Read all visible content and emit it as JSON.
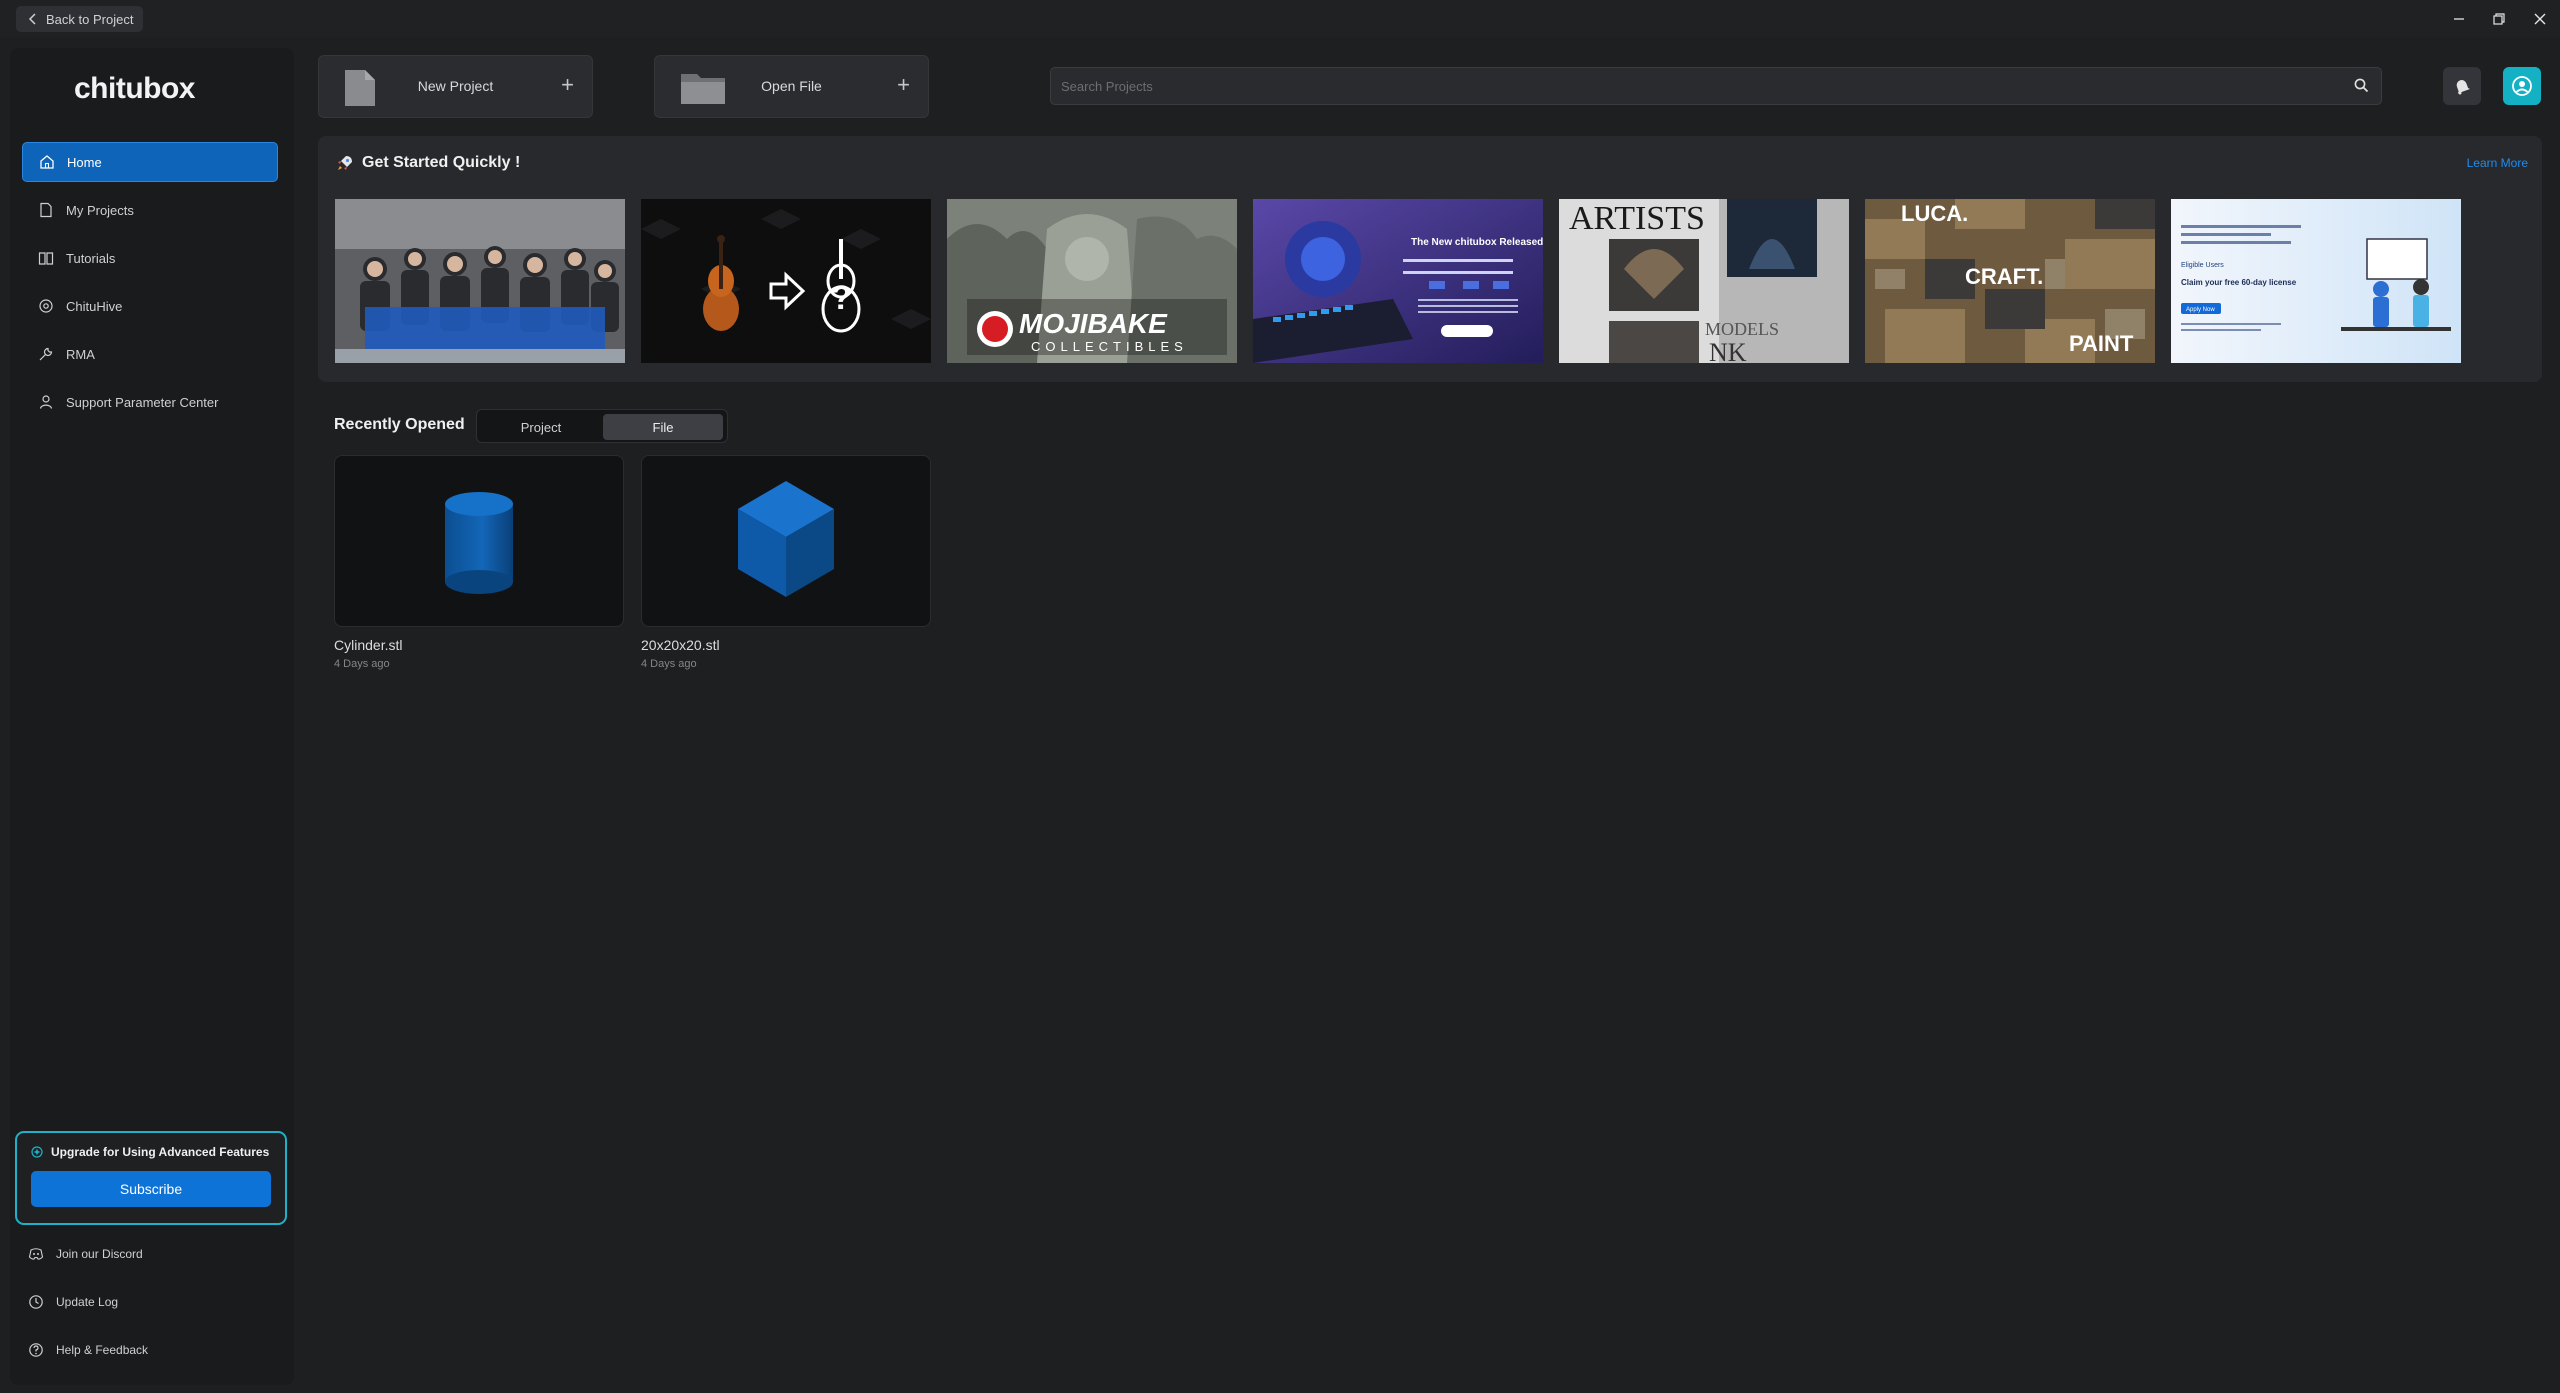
{
  "titlebar": {
    "back_label": "Back to Project",
    "controls": [
      "minimize-icon",
      "restore-icon",
      "close-icon"
    ]
  },
  "sidebar": {
    "logo": "chitubox",
    "items": [
      {
        "label": "Home",
        "icon": "home-icon",
        "active": true
      },
      {
        "label": "My Projects",
        "icon": "document-icon"
      },
      {
        "label": "Tutorials",
        "icon": "book-icon"
      },
      {
        "label": "ChituHive",
        "icon": "hive-icon"
      },
      {
        "label": "RMA",
        "icon": "wrench-icon"
      },
      {
        "label": "Support Parameter Center",
        "icon": "support-icon"
      }
    ],
    "upgrade": {
      "title": "Upgrade for Using Advanced Features",
      "button": "Subscribe"
    },
    "bottom_links": [
      {
        "label": "Join our Discord",
        "icon": "discord-icon"
      },
      {
        "label": "Update Log",
        "icon": "update-icon"
      },
      {
        "label": "Help & Feedback",
        "icon": "help-icon"
      }
    ]
  },
  "actions": {
    "new_project": "New Project",
    "open_file": "Open File",
    "search_placeholder": "Search Projects"
  },
  "get_started": {
    "title": "Get Started Quickly !",
    "learn_more": "Learn More",
    "thumb_texts": {
      "t2": "MOJIBAKE",
      "t2b": "COLLECTIBLES",
      "t3": "The New chitubox Released",
      "t4a": "ARTISTS",
      "t4b": "MODELS",
      "t5a": "LUCA.",
      "t5b": "CRAFT.",
      "t5c": "PAINT",
      "t6a": "Claim your free 60-day license",
      "t6b": "Eligible Users",
      "t6c": "Apply Now"
    }
  },
  "recent": {
    "title": "Recently Opened",
    "tabs": [
      {
        "label": "Project",
        "active": false
      },
      {
        "label": "File",
        "active": true
      }
    ],
    "files": [
      {
        "name": "Cylinder.stl",
        "time": "4 Days ago"
      },
      {
        "name": "20x20x20.stl",
        "time": "4 Days ago"
      }
    ]
  },
  "colors": {
    "accent": "#0e73d6",
    "teal": "#14b0c4",
    "background": "#1e1f21"
  }
}
